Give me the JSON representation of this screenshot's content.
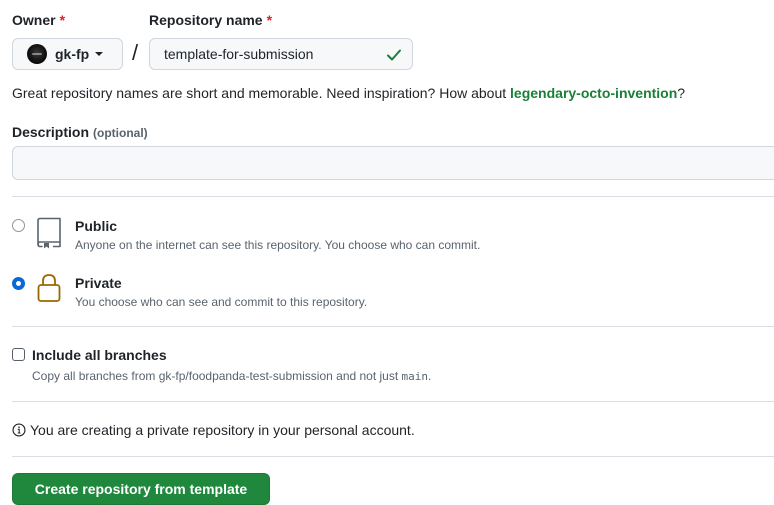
{
  "owner": {
    "label": "Owner",
    "required_mark": "*",
    "value": "gk-fp"
  },
  "repository": {
    "label": "Repository name",
    "required_mark": "*",
    "value": "template-for-submission"
  },
  "hint": {
    "text": "Great repository names are short and memorable. Need inspiration? How about ",
    "suggestion": "legendary-octo-invention",
    "suffix": "?"
  },
  "description": {
    "label": "Description",
    "optional": "(optional)",
    "value": ""
  },
  "visibility": {
    "public": {
      "title": "Public",
      "description": "Anyone on the internet can see this repository. You choose who can commit.",
      "selected": false
    },
    "private": {
      "title": "Private",
      "description": "You choose who can see and commit to this repository.",
      "selected": true
    }
  },
  "branches": {
    "title": "Include all branches",
    "description_prefix": "Copy all branches from gk-fp/foodpanda-test-submission and not just ",
    "description_code": "main",
    "description_suffix": ".",
    "checked": false
  },
  "info": {
    "text": "You are creating a private repository in your personal account."
  },
  "submit": {
    "label": "Create repository from template"
  },
  "colors": {
    "accent_green": "#1f883d",
    "suggestion_green": "#1a7f37",
    "radio_blue": "#0969da",
    "private_lock": "#9a6700",
    "required_red": "#d1242f"
  },
  "icons": {
    "valid": "check-icon",
    "public": "repo-icon",
    "private": "lock-icon",
    "info": "info-icon",
    "dropdown": "chevron-down-icon"
  }
}
